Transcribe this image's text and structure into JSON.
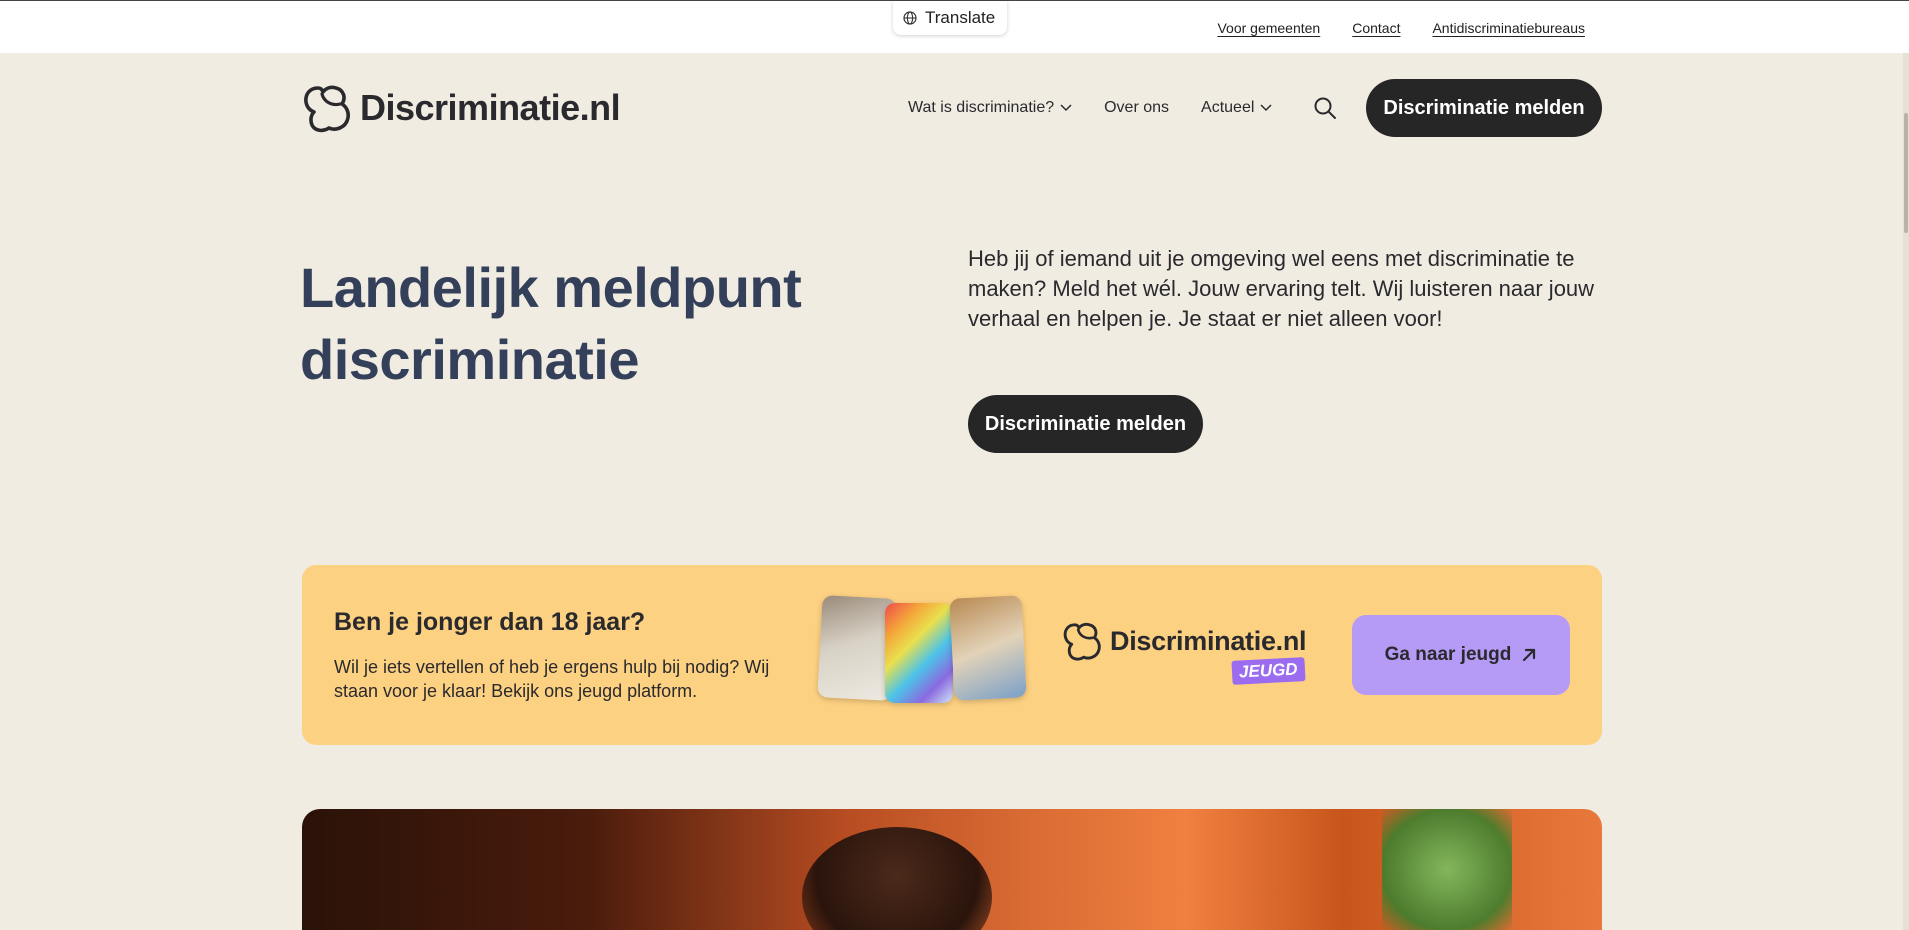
{
  "topbar": {
    "translate_label": "Translate",
    "links": [
      "Voor gemeenten",
      "Contact",
      "Antidiscriminatiebureaus"
    ]
  },
  "header": {
    "logo_text": "Discriminatie.nl",
    "nav": {
      "item_1": "Wat is discriminatie?",
      "item_2": "Over ons",
      "item_3": "Actueel"
    },
    "cta_label": "Discriminatie melden"
  },
  "hero": {
    "title": "Landelijk meldpunt discriminatie",
    "text": "Heb jij of iemand uit je omgeving wel eens met discriminatie te maken? Meld het wél. Jouw ervaring telt. Wij luisteren naar jouw verhaal en helpen je. Je staat er niet alleen voor!",
    "cta_label": "Discriminatie melden"
  },
  "youth": {
    "title": "Ben je jonger dan 18 jaar?",
    "text": "Wil je iets vertellen of heb je ergens hulp bij nodig? Wij staan voor je klaar! Bekijk ons jeugd platform.",
    "logo_text": "Discriminatie.nl",
    "badge": "JEUGD",
    "button_label": "Ga naar jeugd"
  },
  "colors": {
    "background": "#f1ece2",
    "dark_button": "#262626",
    "heading": "#34405a",
    "youth_banner": "#fdd182",
    "youth_button": "#b59af6",
    "badge": "#9b6cf0"
  }
}
